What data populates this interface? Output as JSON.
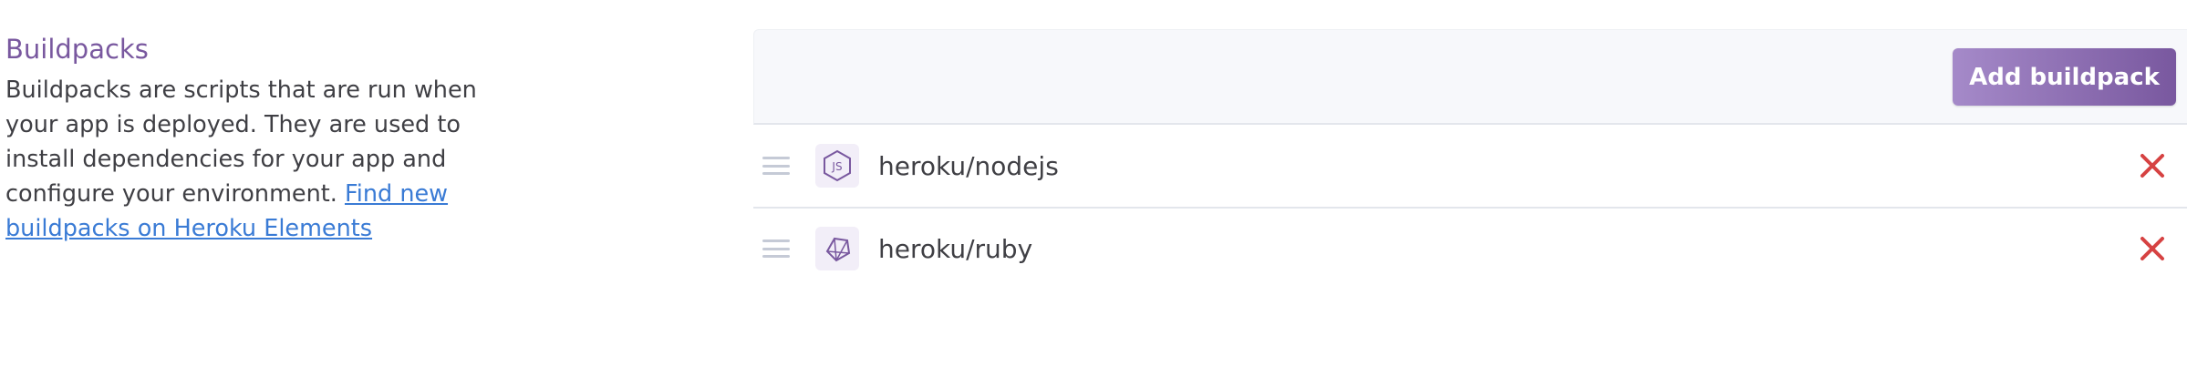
{
  "section": {
    "title": "Buildpacks",
    "description": "Buildpacks are scripts that are run when your app is deployed. They are used to install dependencies for your app and configure your environment.",
    "link_text": "Find new buildpacks on Heroku Elements"
  },
  "toolbar": {
    "add_label": "Add buildpack"
  },
  "buildpacks": [
    {
      "name": "heroku/nodejs",
      "icon": "nodejs-icon"
    },
    {
      "name": "heroku/ruby",
      "icon": "ruby-icon"
    }
  ],
  "colors": {
    "accent": "#79589f",
    "link": "#3a7bd5",
    "remove": "#d64242"
  }
}
